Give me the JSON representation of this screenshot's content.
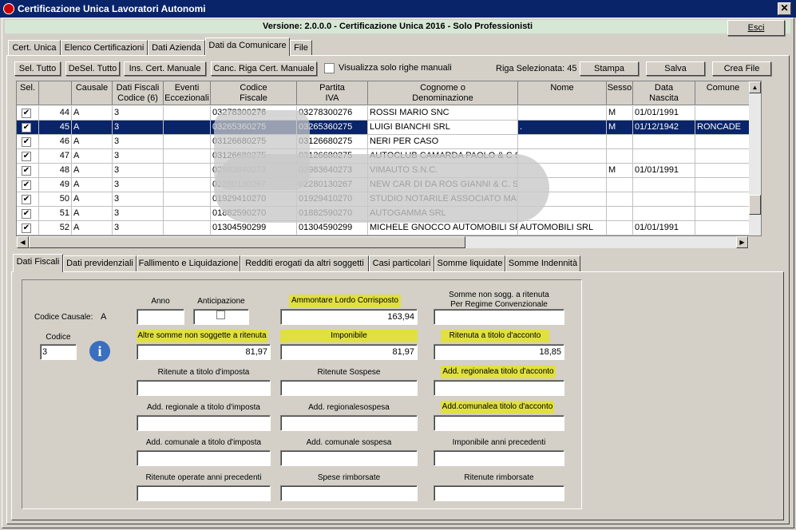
{
  "window": {
    "title": "Certificazione Unica Lavoratori Autonomi",
    "close": "✕"
  },
  "version_text": "Versione: 2.0.0.0 - Certificazione Unica 2016 - Solo Professionisti",
  "esci_label": "Esci",
  "main_tabs": [
    "Cert. Unica",
    "Elenco Certificazioni",
    "Dati Azienda",
    "Dati da Comunicare",
    "File"
  ],
  "toolbar": {
    "sel_tutto": "Sel. Tutto",
    "desel_tutto": "DeSel. Tutto",
    "ins_manuale": "Ins. Cert. Manuale",
    "canc_riga": "Canc. Riga Cert. Manuale",
    "visualizza": "Visualizza solo righe manuali",
    "riga_selezionata": "Riga Selezionata: 45",
    "stampa": "Stampa",
    "salva": "Salva",
    "crea_file": "Crea File"
  },
  "grid": {
    "headers": [
      "Sel.",
      "",
      "Causale",
      "Dati Fiscali\nCodice (6)",
      "Eventi\nEccezionali",
      "Codice\nFiscale",
      "Partita\nIVA",
      "Cognome o\nDenominazione",
      "Nome",
      "Sesso",
      "Data\nNascita",
      "Comune"
    ],
    "rows": [
      {
        "n": "44",
        "causale": "A",
        "codice": "3",
        "cf": "03278300276",
        "piva": "03278300276",
        "nome_den": "ROSSI MARIO SNC",
        "nome": "",
        "sesso": "M",
        "data": "01/01/1991",
        "comune": "",
        "selected": false
      },
      {
        "n": "45",
        "causale": "A",
        "codice": "3",
        "cf": "03265360275",
        "piva": "03265360275",
        "nome_den": "LUIGI BIANCHI SRL",
        "nome": ".",
        "sesso": "M",
        "data": "01/12/1942",
        "comune": "RONCADE",
        "selected": true
      },
      {
        "n": "46",
        "causale": "A",
        "codice": "3",
        "cf": "03126680275",
        "piva": "03126680275",
        "nome_den": "NERI PER CASO",
        "nome": "",
        "sesso": "",
        "data": "",
        "comune": "",
        "selected": false
      },
      {
        "n": "47",
        "causale": "A",
        "codice": "3",
        "cf": "03126680275",
        "piva": "03126680275",
        "nome_den": "AUTOCLUB CAMARDA PAOLO & C SAS",
        "nome": "",
        "sesso": "",
        "data": "",
        "comune": "",
        "selected": false
      },
      {
        "n": "48",
        "causale": "A",
        "codice": "3",
        "cf": "02983640273",
        "piva": "02983640273",
        "nome_den": "VIMAUTO S.N.C.",
        "nome": "",
        "sesso": "M",
        "data": "01/01/1991",
        "comune": "",
        "selected": false
      },
      {
        "n": "49",
        "causale": "A",
        "codice": "3",
        "cf": "02280130267",
        "piva": "02280130267",
        "nome_den": "NEW CAR DI DA ROS GIANNI & C. SNC",
        "nome": "",
        "sesso": "",
        "data": "",
        "comune": "",
        "selected": false
      },
      {
        "n": "50",
        "causale": "A",
        "codice": "3",
        "cf": "01929410270",
        "piva": "01929410270",
        "nome_den": "STUDIO NOTARILE ASSOCIATO MARCO",
        "nome": "",
        "sesso": "",
        "data": "",
        "comune": "",
        "selected": false
      },
      {
        "n": "51",
        "causale": "A",
        "codice": "3",
        "cf": "01882590270",
        "piva": "01882590270",
        "nome_den": "AUTOGAMMA SRL",
        "nome": "",
        "sesso": "",
        "data": "",
        "comune": "",
        "selected": false
      },
      {
        "n": "52",
        "causale": "A",
        "codice": "3",
        "cf": "01304590299",
        "piva": "01304590299",
        "nome_den": "MICHELE GNOCCO AUTOMOBILI SRL",
        "nome": "AUTOMOBILI SRL",
        "sesso": "",
        "data": "01/01/1991",
        "comune": "",
        "selected": false
      }
    ]
  },
  "detail_tabs": [
    "Dati Fiscali",
    "Dati previdenziali",
    "Fallimento e Liquidazione",
    "Redditi erogati da altri soggetti",
    "Casi particolari",
    "Somme liquidate",
    "Somme Indennità"
  ],
  "form": {
    "codice_causale_label": "Codice Causale:",
    "codice_causale_value": "A",
    "codice_label": "Codice",
    "codice_value": "3",
    "anno": "Anno",
    "anticipazione": "Anticipazione",
    "ammontare": "Ammontare Lordo Corrisposto",
    "ammontare_value": "163,94",
    "somme_non_sogg": "Somme non sogg. a ritenuta\nPer Regime Convenzionale",
    "altre_somme": "Altre somme non soggette a ritenuta",
    "altre_somme_value": "81,97",
    "imponibile": "Imponibile",
    "imponibile_value": "81,97",
    "ritenuta_acconto": "Ritenuta a titolo d'acconto",
    "ritenuta_acconto_value": "18,85",
    "ritenute_imposta": "Ritenute a titolo d'imposta",
    "ritenute_sospese": "Ritenute Sospese",
    "add_reg_acconto": "Add. regionalea titolo d'acconto",
    "add_reg_imposta": "Add. regionale a titolo d'imposta",
    "add_reg_sospesa": "Add. regionalesospesa",
    "add_com_acconto": "Add.comunalea titolo d'acconto",
    "add_com_imposta": "Add. comunale a titolo d'imposta",
    "add_com_sospesa": "Add. comunale sospesa",
    "imponibile_prec": "Imponibile anni precedenti",
    "ritenute_prec": "Ritenute operate anni precedenti",
    "spese_rimborsate": "Spese rimborsate",
    "ritenute_rimborsate": "Ritenute rimborsate"
  }
}
